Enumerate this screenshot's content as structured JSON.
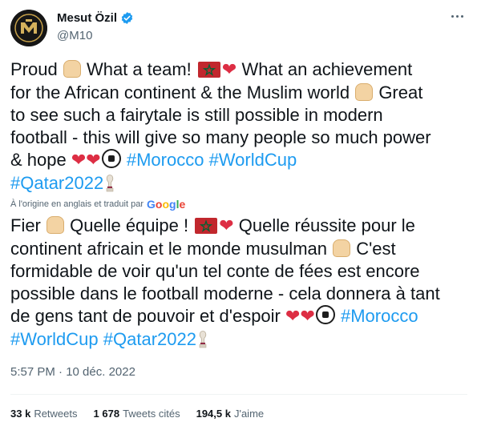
{
  "author": {
    "display_name": "Mesut Özil",
    "handle": "@M10",
    "verified": true
  },
  "tweet": {
    "original_lines": [
      [
        {
          "t": "text",
          "v": "Proud "
        },
        {
          "t": "emoji",
          "v": "praying-hands"
        },
        {
          "t": "text",
          "v": " What a team! "
        },
        {
          "t": "emoji",
          "v": "morocco-flag"
        },
        {
          "t": "emoji",
          "v": "red-heart"
        },
        {
          "t": "text",
          "v": " What an achievement"
        }
      ],
      [
        {
          "t": "text",
          "v": "for the African continent & the Muslim world "
        },
        {
          "t": "emoji",
          "v": "praying-hands"
        },
        {
          "t": "text",
          "v": " Great"
        }
      ],
      [
        {
          "t": "text",
          "v": "to see such a fairytale is still possible in modern"
        }
      ],
      [
        {
          "t": "text",
          "v": "football - this will give so many people so much power"
        }
      ],
      [
        {
          "t": "text",
          "v": "& hope "
        },
        {
          "t": "emoji",
          "v": "red-heart"
        },
        {
          "t": "emoji",
          "v": "red-heart"
        },
        {
          "t": "emoji",
          "v": "soccer-ball"
        },
        {
          "t": "text",
          "v": " "
        },
        {
          "t": "tag",
          "v": "#Morocco"
        },
        {
          "t": "text",
          "v": " "
        },
        {
          "t": "tag",
          "v": "#WorldCup"
        }
      ],
      [
        {
          "t": "tag",
          "v": "#Qatar2022"
        },
        {
          "t": "emoji",
          "v": "world-cup-trophy"
        }
      ]
    ],
    "translation_note": "À l'origine en anglais et traduit par",
    "translation_provider": "Google",
    "translated_lines": [
      [
        {
          "t": "text",
          "v": "Fier "
        },
        {
          "t": "emoji",
          "v": "praying-hands"
        },
        {
          "t": "text",
          "v": " Quelle équipe ! "
        },
        {
          "t": "emoji",
          "v": "morocco-flag"
        },
        {
          "t": "emoji",
          "v": "red-heart"
        },
        {
          "t": "text",
          "v": " Quelle réussite pour le"
        }
      ],
      [
        {
          "t": "text",
          "v": "continent africain et le monde musulman "
        },
        {
          "t": "emoji",
          "v": "praying-hands"
        },
        {
          "t": "text",
          "v": " C'est"
        }
      ],
      [
        {
          "t": "text",
          "v": "formidable de voir qu'un tel conte de fées est encore"
        }
      ],
      [
        {
          "t": "text",
          "v": "possible dans le football moderne - cela donnera à tant"
        }
      ],
      [
        {
          "t": "text",
          "v": "de gens tant de pouvoir et d'espoir "
        },
        {
          "t": "emoji",
          "v": "red-heart"
        },
        {
          "t": "emoji",
          "v": "red-heart"
        },
        {
          "t": "emoji",
          "v": "soccer-ball"
        },
        {
          "t": "text",
          "v": " "
        },
        {
          "t": "tag",
          "v": "#Morocco"
        }
      ],
      [
        {
          "t": "tag",
          "v": "#WorldCup"
        },
        {
          "t": "text",
          "v": " "
        },
        {
          "t": "tag",
          "v": "#Qatar2022"
        },
        {
          "t": "emoji",
          "v": "world-cup-trophy"
        }
      ]
    ],
    "timestamp": "5:57 PM · 10 déc. 2022"
  },
  "stats": [
    {
      "count": "33 k",
      "label": "Retweets",
      "name": "retweets-stat"
    },
    {
      "count": "1 678",
      "label": "Tweets cités",
      "name": "quote-tweets-stat"
    },
    {
      "count": "194,5 k",
      "label": "J'aime",
      "name": "likes-stat"
    }
  ],
  "colors": {
    "link": "#1d9bf0",
    "text": "#0f1419",
    "secondary": "#536471",
    "verified": "#1d9bf0",
    "heart": "#dd2e44",
    "flag_red": "#c1272d",
    "flag_green": "#006233"
  },
  "icons": [
    "verified-badge-icon",
    "more-options-icon",
    "google-logo"
  ]
}
